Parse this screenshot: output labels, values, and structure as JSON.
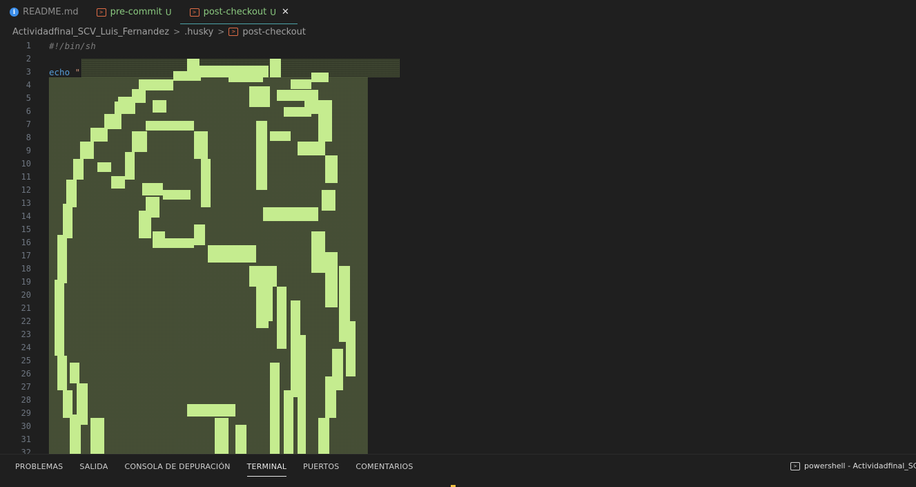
{
  "tabs": [
    {
      "label": "README.md",
      "icon": "info-icon",
      "status": "",
      "active": false
    },
    {
      "label": "pre-commit",
      "icon": "terminal-file-icon",
      "status": "U",
      "active": false
    },
    {
      "label": "post-checkout",
      "icon": "terminal-file-icon",
      "status": "U",
      "active": true,
      "close": "✕"
    }
  ],
  "breadcrumb": {
    "folder": "Actividadfinal_SCV_Luis_Fernandez",
    "subfolder": ".husky",
    "file": "post-checkout",
    "separator": ">"
  },
  "editor": {
    "line_numbers": [
      "1",
      "2",
      "3",
      "4",
      "5",
      "6",
      "7",
      "8",
      "9",
      "10",
      "11",
      "12",
      "13",
      "14",
      "15",
      "16",
      "17",
      "18",
      "19",
      "20",
      "21",
      "22",
      "23",
      "24",
      "25",
      "26",
      "27",
      "28",
      "29",
      "30",
      "31",
      "32"
    ],
    "line1": "#!/bin/sh",
    "line3_keyword": "echo",
    "line3_string": " \""
  },
  "panel": {
    "tabs": [
      "PROBLEMAS",
      "SALIDA",
      "CONSOLA DE DEPURACIÓN",
      "TERMINAL",
      "PUERTOS",
      "COMENTARIOS"
    ],
    "active_tab": "TERMINAL",
    "terminal_title": "powershell - Actividadfinal_SCV_L"
  },
  "colors": {
    "accent": "#4da3a8",
    "untracked": "#8ac87f",
    "art_light": "#c5ec8f"
  }
}
